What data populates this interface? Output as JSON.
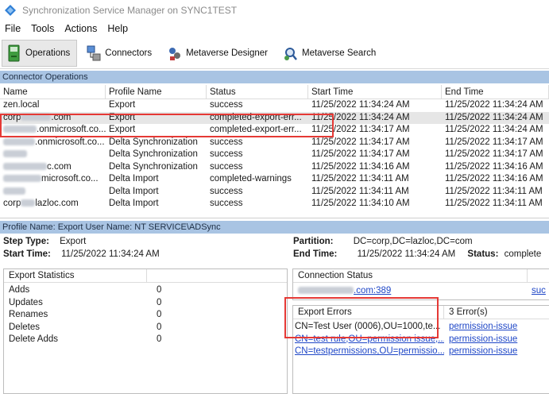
{
  "window": {
    "title": "Synchronization Service Manager on SYNC1TEST"
  },
  "menu": [
    "File",
    "Tools",
    "Actions",
    "Help"
  ],
  "toolbar": {
    "operations": "Operations",
    "connectors": "Connectors",
    "metaverse_designer": "Metaverse Designer",
    "metaverse_search": "Metaverse Search"
  },
  "connector_ops": {
    "header": "Connector Operations",
    "columns": [
      "Name",
      "Profile Name",
      "Status",
      "Start Time",
      "End Time"
    ],
    "rows": [
      {
        "name": "zen.local",
        "name_prefix": "zen.local",
        "profile": "Export",
        "status": "success",
        "start": "11/25/2022 11:34:24 AM",
        "end": "11/25/2022 11:34:24 AM"
      },
      {
        "name": "corp.com",
        "name_prefix": "corp",
        "name_suffix": ".com",
        "profile": "Export",
        "status": "completed-export-err...",
        "start": "11/25/2022 11:34:24 AM",
        "end": "11/25/2022 11:34:24 AM",
        "selected": true
      },
      {
        "name": ".onmicrosoft.co...",
        "name_suffix": ".onmicrosoft.co...",
        "profile": "Export",
        "status": "completed-export-err...",
        "start": "11/25/2022 11:34:17 AM",
        "end": "11/25/2022 11:34:24 AM"
      },
      {
        "name": ".onmicrosoft.co...",
        "name_suffix": ".onmicrosoft.co...",
        "profile": "Delta Synchronization",
        "status": "success",
        "start": "11/25/2022 11:34:17 AM",
        "end": "11/25/2022 11:34:17 AM"
      },
      {
        "name": "",
        "profile": "Delta Synchronization",
        "status": "success",
        "start": "11/25/2022 11:34:17 AM",
        "end": "11/25/2022 11:34:17 AM"
      },
      {
        "name": "c.com",
        "name_suffix": "c.com",
        "profile": "Delta Synchronization",
        "status": "success",
        "start": "11/25/2022 11:34:16 AM",
        "end": "11/25/2022 11:34:16 AM"
      },
      {
        "name": "microsoft.co...",
        "name_suffix": "microsoft.co...",
        "profile": "Delta Import",
        "status": "completed-warnings",
        "start": "11/25/2022 11:34:11 AM",
        "end": "11/25/2022 11:34:16 AM"
      },
      {
        "name": "",
        "profile": "Delta Import",
        "status": "success",
        "start": "11/25/2022 11:34:11 AM",
        "end": "11/25/2022 11:34:11 AM"
      },
      {
        "name": "corp.lazloc.com",
        "name_prefix": "corp",
        "name_suffix": "lazloc.com",
        "profile": "Delta Import",
        "status": "success",
        "start": "11/25/2022 11:34:10 AM",
        "end": "11/25/2022 11:34:11 AM"
      }
    ]
  },
  "profile_bar": "Profile Name: Export  User Name: NT SERVICE\\ADSync",
  "step": {
    "step_type_label": "Step Type:",
    "step_type_value": "Export",
    "start_time_label": "Start Time:",
    "start_time_value": "11/25/2022 11:34:24 AM",
    "partition_label": "Partition:",
    "partition_value": "DC=corp,DC=lazloc,DC=com",
    "end_time_label": "End Time:",
    "end_time_value": "11/25/2022 11:34:24 AM",
    "status_label": "Status:",
    "status_value": "complete"
  },
  "export_stats": {
    "header": "Export Statistics",
    "rows": [
      {
        "label": "Adds",
        "value": "0"
      },
      {
        "label": "Updates",
        "value": "0"
      },
      {
        "label": "Renames",
        "value": "0"
      },
      {
        "label": "Deletes",
        "value": "0"
      },
      {
        "label": "Delete Adds",
        "value": "0"
      }
    ]
  },
  "connection_status": {
    "header": "Connection Status",
    "server_suffix": ".com:389",
    "result": "suc"
  },
  "export_errors": {
    "header": "Export Errors",
    "count": "3 Error(s)",
    "rows": [
      {
        "dn": "CN=Test User (0006),OU=1000,te...",
        "error": "permission-issue"
      },
      {
        "dn": "CN=test rule,OU=permission issue,...",
        "error": "permission-issue"
      },
      {
        "dn": "CN=testpermissions,OU=permissio...",
        "error": "permission-issue"
      }
    ]
  }
}
